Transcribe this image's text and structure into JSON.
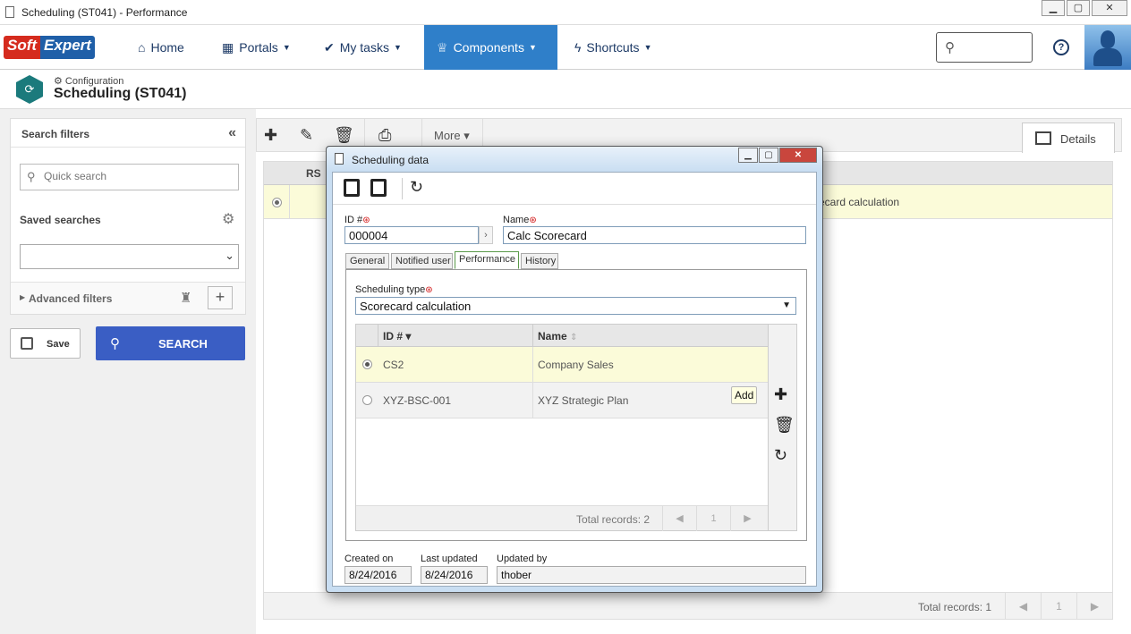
{
  "os": {
    "title": "Scheduling (ST041) - Performance"
  },
  "nav": {
    "logo_soft": "Soft",
    "logo_expert": "Expert",
    "items": [
      {
        "label": "Home",
        "icon": "home-icon"
      },
      {
        "label": "Portals",
        "icon": "grid-icon"
      },
      {
        "label": "My tasks",
        "icon": "check-icon"
      },
      {
        "label": "Components",
        "icon": "trophy-icon",
        "active": true
      },
      {
        "label": "Shortcuts",
        "icon": "bolt-icon"
      }
    ]
  },
  "header": {
    "breadcrumb": "Configuration",
    "title": "Scheduling (ST041)"
  },
  "filters": {
    "title": "Search filters",
    "quick_search_placeholder": "Quick search",
    "saved_searches": "Saved searches",
    "advanced_filters": "Advanced filters",
    "save_label": "Save",
    "search_label": "SEARCH"
  },
  "main": {
    "more_label": "More",
    "details_tab": "Details",
    "grid_column_abbrev": "RS",
    "row_name_fragment": "ecard calculation",
    "total_records": "Total records: 1",
    "page": "1"
  },
  "modal": {
    "title": "Scheduling data",
    "id_label": "ID #",
    "id_value": "000004",
    "name_label": "Name",
    "name_value": "Calc Scorecard",
    "tabs": [
      "General",
      "Notified user",
      "Performance",
      "History"
    ],
    "scheduling_type_label": "Scheduling type",
    "scheduling_type_value": "Scorecard calculation",
    "grid": {
      "col_id": "ID #",
      "col_name": "Name",
      "rows": [
        {
          "id": "CS2",
          "name": "Company Sales",
          "selected": true
        },
        {
          "id": "XYZ-BSC-001",
          "name": "XYZ Strategic Plan",
          "selected": false
        }
      ],
      "total_records": "Total records: 2",
      "page": "1"
    },
    "add_tooltip": "Add",
    "created_on_label": "Created on",
    "created_on": "8/24/2016",
    "last_updated_label": "Last updated",
    "last_updated": "8/24/2016",
    "updated_by_label": "Updated by",
    "updated_by": "thober"
  },
  "colors": {
    "accent": "#2f7fc9",
    "search_button": "#3a5ec4",
    "selected_row": "#fbfbd9",
    "brand_red": "#d52b1e",
    "brand_blue": "#1f5fa8"
  }
}
